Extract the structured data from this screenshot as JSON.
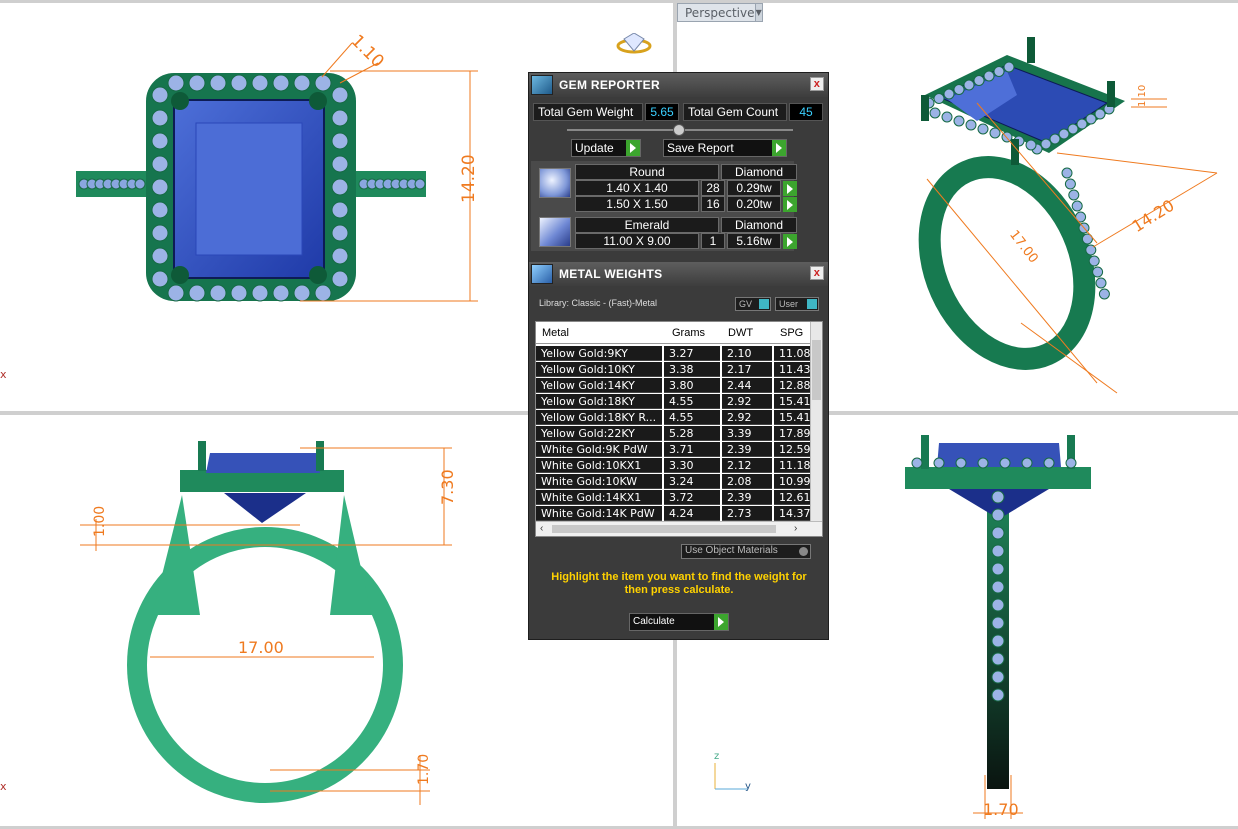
{
  "viewport": {
    "perspective_label": "Perspective",
    "axis_x": "x",
    "axis_z": "z",
    "axis_y": "y",
    "dims": {
      "top_thickness": "1.10",
      "top_height": "14.20",
      "persp_width": "17.00",
      "persp_length": "14.20",
      "persp_small": "1.10",
      "front_height": "7.30",
      "front_gap": "1.00",
      "front_inner": "17.00",
      "front_base": "1.70",
      "side_base": "1.70"
    }
  },
  "gem_reporter": {
    "title": "GEM REPORTER",
    "close": "x",
    "total_weight_label": "Total Gem Weight",
    "total_weight_value": "5.65",
    "total_count_label": "Total Gem Count",
    "total_count_value": "45",
    "update_label": "Update",
    "save_report_label": "Save Report",
    "groups": [
      {
        "shape": "Round",
        "material": "Diamond",
        "rows": [
          {
            "size": "1.40 X 1.40",
            "count": "28",
            "weight": "0.29tw"
          },
          {
            "size": "1.50 X 1.50",
            "count": "16",
            "weight": "0.20tw"
          }
        ]
      },
      {
        "shape": "Emerald",
        "material": "Diamond",
        "rows": [
          {
            "size": "11.00 X 9.00",
            "count": "1",
            "weight": "5.16tw"
          }
        ]
      }
    ]
  },
  "metal_weights": {
    "title": "METAL WEIGHTS",
    "close": "x",
    "library_label": "Library: Classic - (Fast)-Metal",
    "gv_label": "GV",
    "user_label": "User",
    "columns": [
      "Metal",
      "Grams",
      "DWT",
      "SPG"
    ],
    "rows": [
      [
        "Yellow Gold:9KY",
        "3.27",
        "2.10",
        "11.08"
      ],
      [
        "Yellow Gold:10KY",
        "3.38",
        "2.17",
        "11.43"
      ],
      [
        "Yellow Gold:14KY",
        "3.80",
        "2.44",
        "12.88"
      ],
      [
        "Yellow Gold:18KY",
        "4.55",
        "2.92",
        "15.41"
      ],
      [
        "Yellow Gold:18KY R...",
        "4.55",
        "2.92",
        "15.41"
      ],
      [
        "Yellow Gold:22KY",
        "5.28",
        "3.39",
        "17.89"
      ],
      [
        "White Gold:9K PdW",
        "3.71",
        "2.39",
        "12.59"
      ],
      [
        "White Gold:10KX1",
        "3.30",
        "2.12",
        "11.18"
      ],
      [
        "White Gold:10KW",
        "3.24",
        "2.08",
        "10.99"
      ],
      [
        "White Gold:14KX1",
        "3.72",
        "2.39",
        "12.61"
      ],
      [
        "White Gold:14K PdW",
        "4.24",
        "2.73",
        "14.37"
      ]
    ],
    "use_object_materials_label": "Use Object Materials",
    "hint": "Highlight the item you want to find the weight for then press calculate.",
    "calculate_label": "Calculate"
  }
}
